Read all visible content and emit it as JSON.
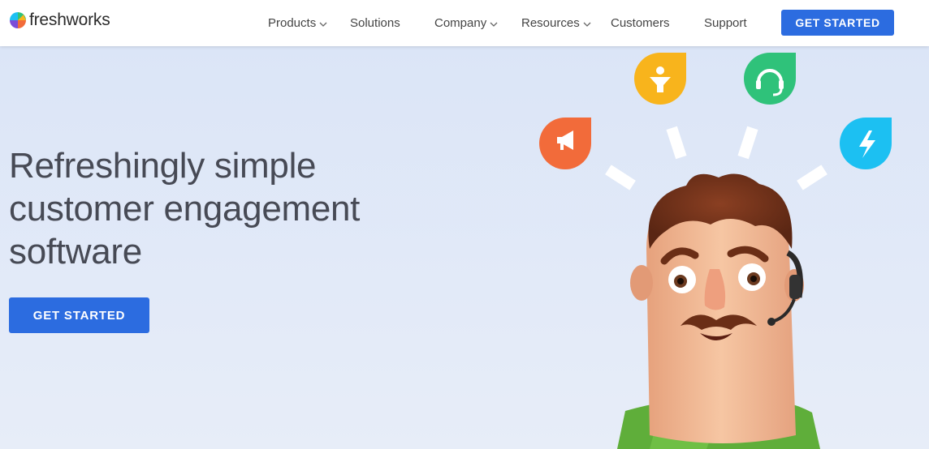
{
  "brand": {
    "name": "freshworks"
  },
  "nav": {
    "items": [
      {
        "label": "Products",
        "dropdown": true
      },
      {
        "label": "Solutions",
        "dropdown": false
      },
      {
        "label": "Company",
        "dropdown": true
      },
      {
        "label": "Resources",
        "dropdown": true
      },
      {
        "label": "Customers",
        "dropdown": false
      },
      {
        "label": "Support",
        "dropdown": false
      }
    ],
    "cta_label": "GET STARTED"
  },
  "hero": {
    "headline_lines": [
      "Refreshingly simple",
      "customer engagement",
      "software"
    ],
    "cta_label": "GET STARTED"
  },
  "icons": [
    {
      "name": "megaphone-icon",
      "color": "#f26b3a"
    },
    {
      "name": "funnel-person-icon",
      "color": "#f8b41c"
    },
    {
      "name": "headset-icon",
      "color": "#2fc27a"
    },
    {
      "name": "lightning-icon",
      "color": "#1cc0f2"
    }
  ],
  "colors": {
    "accent": "#2c6ce0",
    "hero_bg": "#dfe8f8",
    "text": "#474a55"
  }
}
